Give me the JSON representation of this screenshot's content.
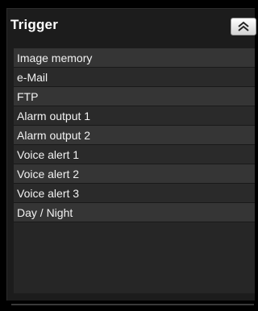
{
  "panel": {
    "title": "Trigger",
    "collapse_icon": "double-chevron-up-icon"
  },
  "trigger_list": {
    "items": [
      {
        "label": "Image memory"
      },
      {
        "label": "e-Mail"
      },
      {
        "label": "FTP"
      },
      {
        "label": "Alarm output 1"
      },
      {
        "label": "Alarm output 2"
      },
      {
        "label": "Voice alert 1"
      },
      {
        "label": "Voice alert 2"
      },
      {
        "label": "Voice alert 3"
      },
      {
        "label": "Day / Night"
      }
    ]
  },
  "colors": {
    "background": "#000000",
    "panel": "#1c1c1c",
    "row_odd": "#353535",
    "row_even": "#2a2a2a",
    "text": "#f2f2f2"
  }
}
